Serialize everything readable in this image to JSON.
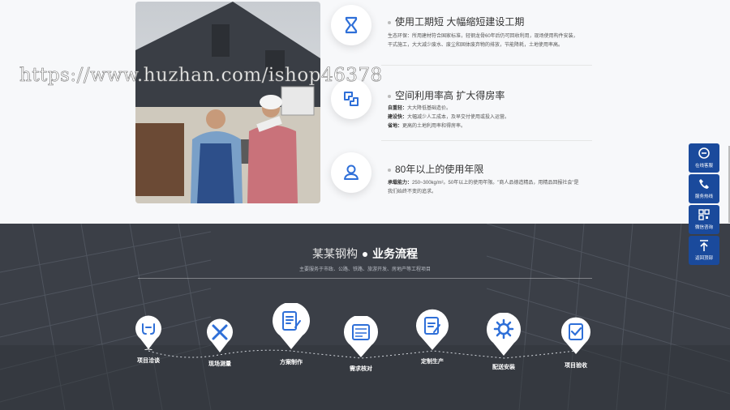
{
  "watermark": "https://www.huzhan.com/ishop46378",
  "features": [
    {
      "title": "使用工期短 大幅缩短建设工期",
      "icon": "hourglass-icon",
      "lines": [
        {
          "label": "",
          "text": "生态环保：所用建材符合国家标准，轻钢龙骨60年后仍可回收利用，现场使用构件安装，干式施工，大大减少废水、废尘和固体废弃物的排放，节能降耗，土地使用率高。"
        }
      ]
    },
    {
      "title": "空间利用率高 扩大得房率",
      "icon": "space-icon",
      "lines": [
        {
          "label": "自重轻：",
          "text": "大大降低基础造价。"
        },
        {
          "label": "建设快：",
          "text": "大幅减少人工成本，及早交付使用或投入运营。"
        },
        {
          "label": "省地：",
          "text": "更高的土地利用率和得房率。"
        }
      ]
    },
    {
      "title": "80年以上的使用年限",
      "icon": "user-icon",
      "lines": [
        {
          "label": "承载能力：",
          "text": "250~300kg/m²。50年以上的使用年限。\"商人品德造精品，用精品回报社会\"是我们始终不变的追求。"
        }
      ]
    }
  ],
  "process": {
    "title_prefix": "某某钢构",
    "title_main": "业务流程",
    "subtitle": "主要服务于市政、公路、铁路、旅游开发、房地产等工程项目",
    "steps": [
      {
        "label": "项目洽谈",
        "icon": "handshake-icon"
      },
      {
        "label": "现场测量",
        "icon": "ruler-pencil-icon"
      },
      {
        "label": "方案制作",
        "icon": "document-edit-icon"
      },
      {
        "label": "需求核对",
        "icon": "checklist-icon"
      },
      {
        "label": "定制生产",
        "icon": "clipboard-edit-icon"
      },
      {
        "label": "配送安装",
        "icon": "gear-icon"
      },
      {
        "label": "项目验收",
        "icon": "clipboard-check-icon"
      }
    ]
  },
  "sidebar": [
    {
      "label": "在线客服",
      "icon": "chat-icon"
    },
    {
      "label": "服务热线",
      "icon": "phone-icon"
    },
    {
      "label": "微信咨询",
      "icon": "qrcode-icon"
    },
    {
      "label": "返回顶部",
      "icon": "arrow-up-icon"
    }
  ],
  "colors": {
    "brand_blue": "#1a4a9c",
    "icon_blue": "#2e6fd8",
    "dark_bg": "#3a3d44"
  }
}
